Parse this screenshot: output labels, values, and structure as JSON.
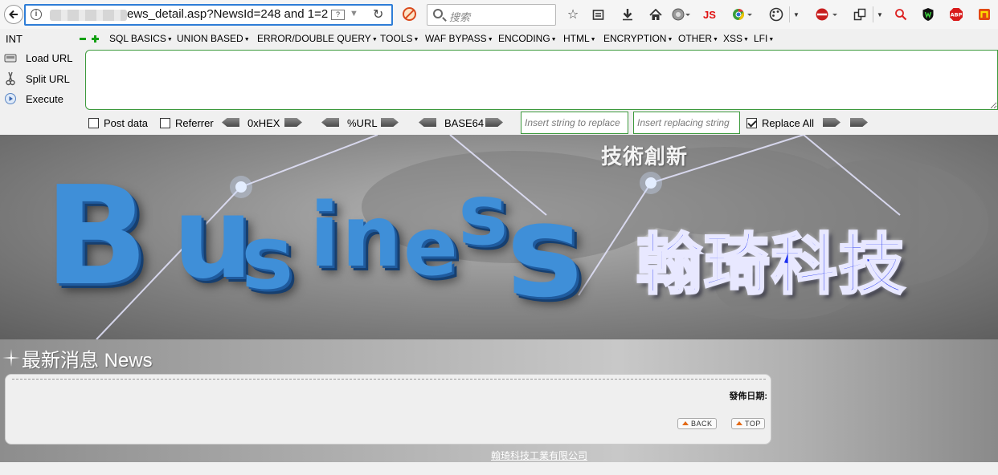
{
  "browser": {
    "url_visible": "ews_detail.asp?NewsId=248 and 1=2",
    "search_placeholder": "搜索",
    "toolbar_js_label": "JS",
    "addon_abp_label": "ABP"
  },
  "hackbar": {
    "int_label": "INT",
    "menu": [
      {
        "label": "SQL BASICS"
      },
      {
        "label": "UNION BASED"
      },
      {
        "label": "ERROR/DOUBLE QUERY"
      },
      {
        "label": "TOOLS"
      },
      {
        "label": "WAF BYPASS"
      },
      {
        "label": "ENCODING"
      },
      {
        "label": "HTML"
      },
      {
        "label": "ENCRYPTION"
      },
      {
        "label": "OTHER"
      },
      {
        "label": "XSS"
      },
      {
        "label": "LFI"
      }
    ],
    "actions": {
      "load_url": "Load URL",
      "split_url": "Split URL",
      "execute": "Execute"
    },
    "textarea_value": "",
    "options": {
      "post_data": "Post data",
      "post_data_checked": false,
      "referrer": "Referrer",
      "referrer_checked": false,
      "hex": "0xHEX",
      "url": "%URL",
      "base64": "BASE64",
      "replace_find_placeholder": "Insert string to replace",
      "replace_with_placeholder": "Insert replacing string",
      "replace_all": "Replace All",
      "replace_all_checked": true
    }
  },
  "page": {
    "banner_tagline": "技術創新",
    "banner_wordmark": [
      "B",
      "u",
      "s",
      "i",
      "n",
      "e",
      "s",
      "s"
    ],
    "brand_name": "翰琦科技",
    "news_heading": "最新消息 News",
    "post_date_label": "發佈日期:",
    "back_label": "BACK",
    "top_label": "TOP",
    "footer_company": "翰琦科技工業有限公司"
  },
  "colors": {
    "url_focus": "#2e7dd7",
    "hackbar_border": "#3d9a3d",
    "brand_blue": "#1b2ff0",
    "wordmark_blue": "#3f8fd8"
  }
}
